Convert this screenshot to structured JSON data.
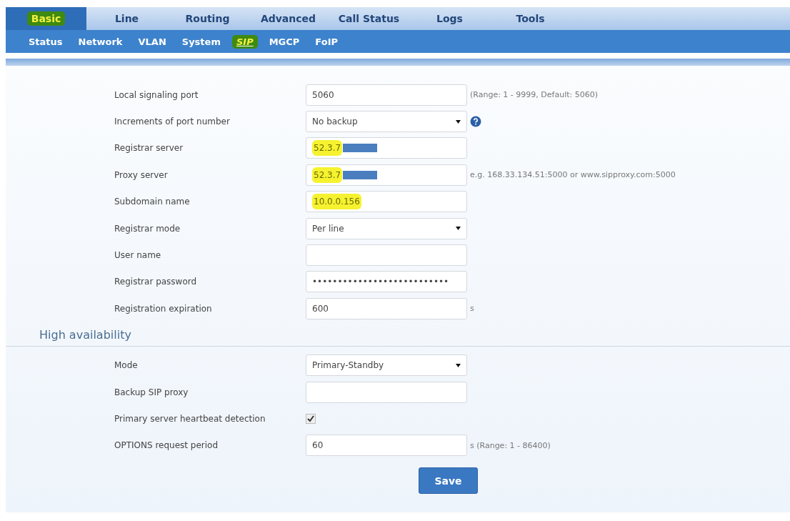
{
  "tabs": [
    {
      "label": "Basic",
      "selected": true,
      "highlighted": true
    },
    {
      "label": "Line",
      "selected": false
    },
    {
      "label": "Routing",
      "selected": false
    },
    {
      "label": "Advanced",
      "selected": false
    },
    {
      "label": "Call Status",
      "selected": false
    },
    {
      "label": "Logs",
      "selected": false
    },
    {
      "label": "Tools",
      "selected": false
    }
  ],
  "subtabs": [
    {
      "label": "Status",
      "selected": false
    },
    {
      "label": "Network",
      "selected": false
    },
    {
      "label": "VLAN",
      "selected": false
    },
    {
      "label": "System",
      "selected": false
    },
    {
      "label": "SIP",
      "selected": true,
      "highlighted": true
    },
    {
      "label": "MGCP",
      "selected": false
    },
    {
      "label": "FoIP",
      "selected": false
    }
  ],
  "sip_fields": [
    {
      "kind": "text",
      "label": "Local signaling port",
      "value": "5060",
      "hint": "(Range: 1 - 9999, Default: 5060)"
    },
    {
      "kind": "select",
      "label": "Increments of port number",
      "value": "No backup",
      "help": true
    },
    {
      "kind": "text",
      "label": "Registrar server",
      "value": "52.3.7",
      "highlighted": true,
      "redacted": true
    },
    {
      "kind": "text",
      "label": "Proxy server",
      "value": "52.3.7",
      "hint": "e.g. 168.33.134.51:5000 or www.sipproxy.com:5000",
      "highlighted": true,
      "redacted": true
    },
    {
      "kind": "text",
      "label": "Subdomain name",
      "value": "10.0.0.156",
      "highlighted": true
    },
    {
      "kind": "select",
      "label": "Registrar mode",
      "value": "Per line"
    },
    {
      "kind": "text",
      "label": "User name"
    },
    {
      "kind": "text",
      "label": "Registrar password",
      "value": "•••••••••••••••••••••••••••"
    },
    {
      "kind": "text",
      "label": "Registration expiration",
      "value": "600",
      "hint": "s"
    }
  ],
  "high_availability": {
    "title": "High availability",
    "fields": [
      {
        "kind": "select",
        "label": "Mode",
        "value": "Primary-Standby"
      },
      {
        "kind": "text",
        "label": "Backup SIP proxy"
      },
      {
        "kind": "checkbox",
        "label": "Primary server heartbeat detection",
        "checked": true
      },
      {
        "kind": "text",
        "label": "OPTIONS request period",
        "value": "60",
        "hint": "s (Range: 1 - 86400)"
      }
    ]
  },
  "save_button": "Save"
}
